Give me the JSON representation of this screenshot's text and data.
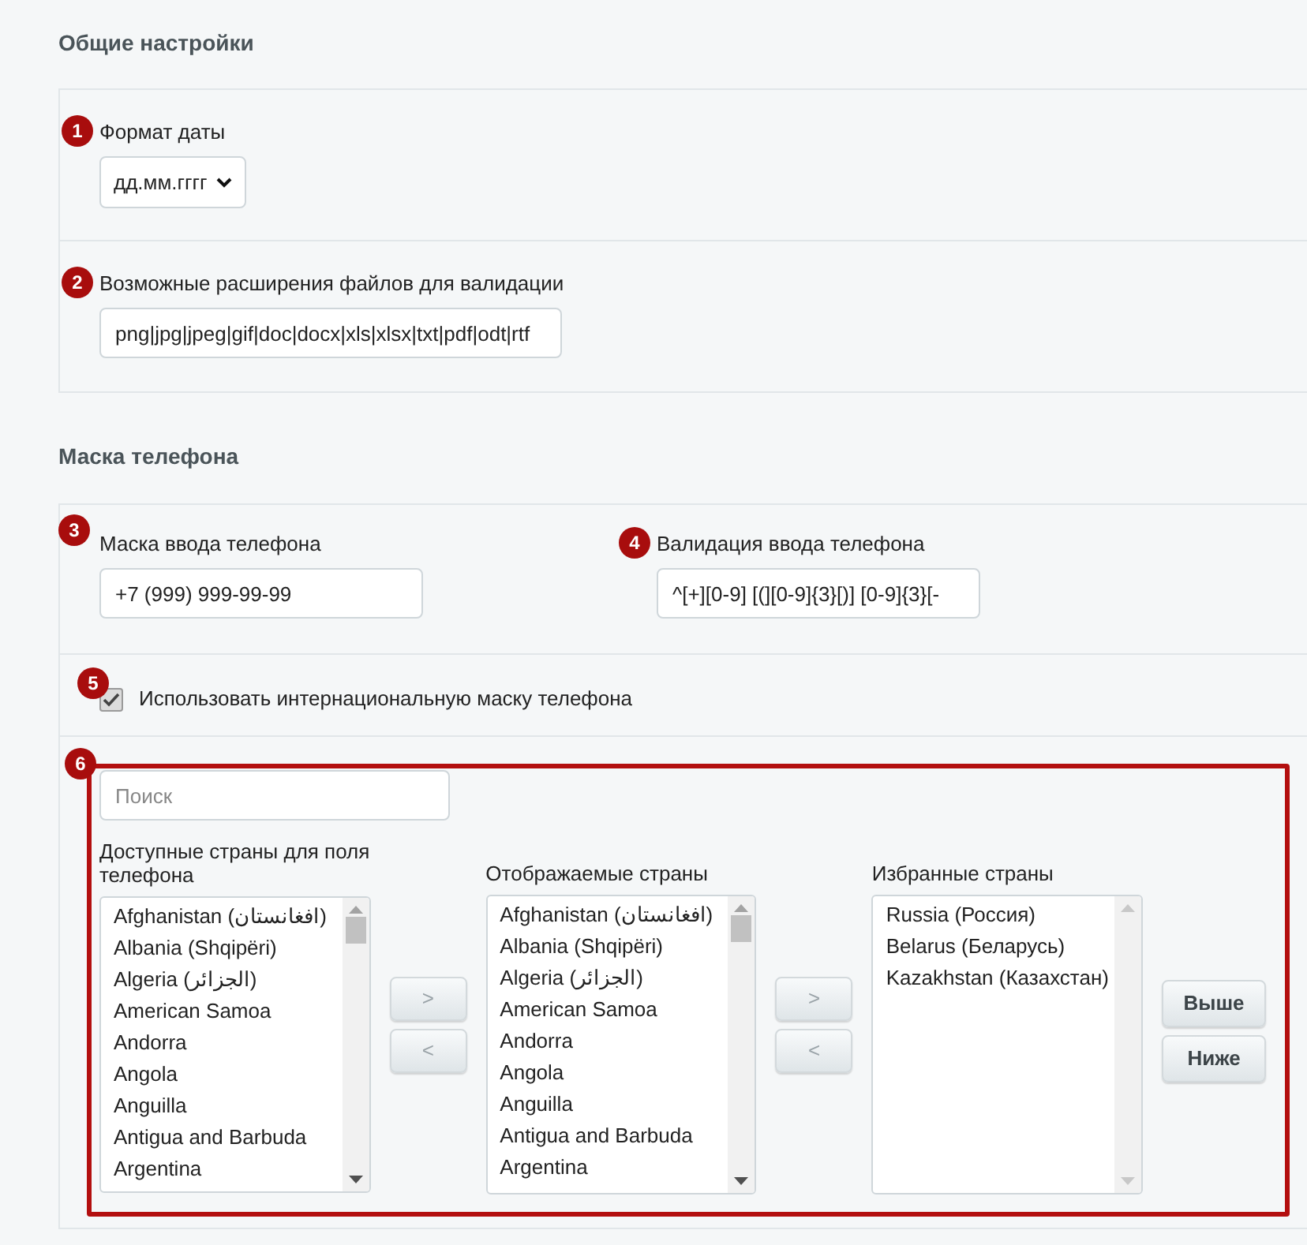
{
  "sections": [
    {
      "title": "Общие настройки",
      "panels": [
        {
          "kind": "fields",
          "fields": [
            {
              "kind": "select",
              "marker": "1",
              "label": "Формат даты",
              "value": "дд.мм.гггг"
            }
          ]
        },
        {
          "kind": "fields",
          "fields": [
            {
              "kind": "input",
              "marker": "2",
              "label": "Возможные расширения файлов для валидации",
              "value": "png|jpg|jpeg|gif|doc|docx|xls|xlsx|txt|pdf|odt|rtf"
            }
          ]
        }
      ]
    },
    {
      "title": "Маска телефона",
      "panels": [
        {
          "kind": "fields",
          "fields": [
            {
              "kind": "input",
              "marker": "3",
              "label": "Маска ввода телефона",
              "value": "+7 (999) 999-99-99"
            },
            {
              "kind": "input",
              "marker": "4",
              "label": "Валидация ввода телефона",
              "value": "^[+][0-9] [(][0-9]{3}[)] [0-9]{3}[-"
            }
          ]
        },
        {
          "kind": "checkbox",
          "marker": "5",
          "label": "Использовать интернациональную маску телефона",
          "checked": true
        },
        {
          "kind": "country_picker",
          "marker": "6",
          "search": {
            "placeholder": "Поиск"
          },
          "lists": [
            {
              "label": "Доступные страны для поля телефона",
              "items": [
                "Afghanistan (افغانستان)",
                "Albania (Shqipëri)",
                "Algeria (الجزائر)",
                "American Samoa",
                "Andorra",
                "Angola",
                "Anguilla",
                "Antigua and Barbuda",
                "Argentina"
              ]
            },
            {
              "label": "Отображаемые страны",
              "items": [
                "Afghanistan (افغانستان)",
                "Albania (Shqipëri)",
                "Algeria (الجزائر)",
                "American Samoa",
                "Andorra",
                "Angola",
                "Anguilla",
                "Antigua and Barbuda",
                "Argentina"
              ]
            },
            {
              "label": "Избранные страны",
              "items": [
                "Russia (Россия)",
                "Belarus (Беларусь)",
                "Kazakhstan (Казахстан)"
              ]
            }
          ],
          "move_buttons": [
            [
              {
                "label": ">",
                "disabled": true
              },
              {
                "label": "<",
                "disabled": true
              }
            ],
            [
              {
                "label": ">",
                "disabled": true
              },
              {
                "label": "<",
                "disabled": true
              }
            ]
          ],
          "order_buttons": [
            {
              "label": "Выше",
              "disabled": false
            },
            {
              "label": "Ниже",
              "disabled": false
            }
          ]
        }
      ]
    }
  ]
}
